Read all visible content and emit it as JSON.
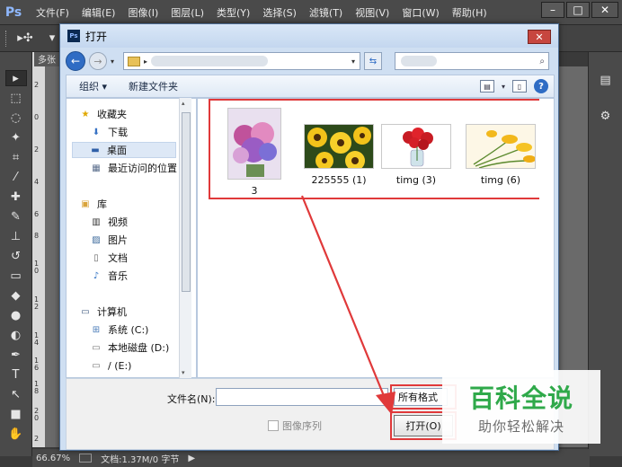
{
  "app": {
    "logo": "Ps",
    "menu": [
      "文件(F)",
      "编辑(E)",
      "图像(I)",
      "图层(L)",
      "类型(Y)",
      "选择(S)",
      "滤镜(T)",
      "视图(V)",
      "窗口(W)",
      "帮助(H)"
    ],
    "doc_tab": "多张",
    "ruler_marks": [
      "2",
      "0",
      "2",
      "4",
      "6",
      "8",
      "1\n0",
      "1\n2",
      "1\n4",
      "1\n6",
      "1\n8",
      "2\n0",
      "2"
    ]
  },
  "status": {
    "zoom": "66.67%",
    "doc_info": "文档:1.37M/0 字节"
  },
  "dialog": {
    "title": "打开",
    "close_symbol": "✕",
    "organize": "组织 ▾",
    "new_folder": "新建文件夹",
    "nav": {
      "favorites": "收藏夹",
      "downloads": "下载",
      "desktop": "桌面",
      "recent": "最近访问的位置",
      "libraries": "库",
      "videos": "视频",
      "pictures": "图片",
      "documents": "文档",
      "music": "音乐",
      "computer": "计算机",
      "drive_c": "系统 (C:)",
      "drive_d": "本地磁盘 (D:)",
      "drive_e": "/ (E:)"
    },
    "files": [
      {
        "name": "3"
      },
      {
        "name": "225555 (1)"
      },
      {
        "name": "timg (3)"
      },
      {
        "name": "timg (6)"
      }
    ],
    "filename_label": "文件名(N):",
    "filename_value": "",
    "filetype": "所有格式",
    "image_sequence": "图像序列",
    "open_button": "打开(O)"
  },
  "watermark": {
    "big": "百科全说",
    "small": "助你轻松解决"
  },
  "colors": {
    "highlight": "#e0393a",
    "watermark_green": "#2fa94a"
  }
}
